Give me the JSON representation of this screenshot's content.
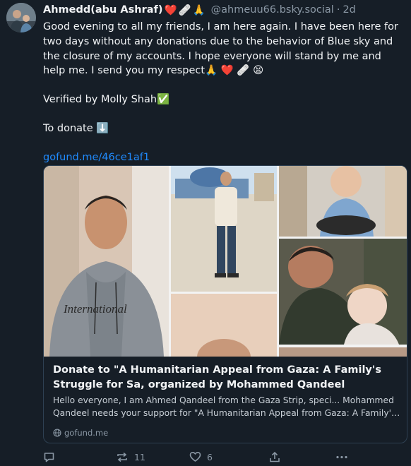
{
  "post": {
    "author": "Ahmedd(abu Ashraf)",
    "author_emojis": [
      "❤️",
      "🩹",
      "🙏"
    ],
    "handle": "@ahmeuu66.bsky.social",
    "separator": "·",
    "time": "2d",
    "text_paragraph_1": "Good evening to all my friends, I am here again. I have been here for two days without any donations due to the behavior of Blue sky and the closure of my accounts. I hope everyone will stand by me and help me. I send you my respect",
    "text_paragraph_1_emojis": [
      "🙏",
      "❤️",
      "🩹",
      "😫"
    ],
    "verified_line": "Verified by Molly Shah",
    "verified_emoji": "✅",
    "donate_line": "To donate",
    "donate_emoji": "⬇️",
    "link_text": "gofund.me/46ce1af1"
  },
  "card": {
    "title": "Donate to \"A Humanitarian Appeal from Gaza: A Family's Struggle for Sa, organized by Mohammed  Qandeel",
    "description_line_1": "Hello everyone, I am Ahmed Qandeel from the Gaza Strip, speci... Mohammed",
    "description_line_2": "Qandeel needs your support for \"A Humanitarian Appeal from Gaza: A Family's...",
    "domain": "gofund.me",
    "image_overlay_text": "International"
  },
  "actions": {
    "reply_count": "",
    "repost_count": "11",
    "like_count": "6"
  },
  "colors": {
    "background": "#161e27",
    "text": "#f1f3f5",
    "muted": "#8b98a5",
    "link": "#208bfe",
    "card_border": "#2e4052"
  }
}
